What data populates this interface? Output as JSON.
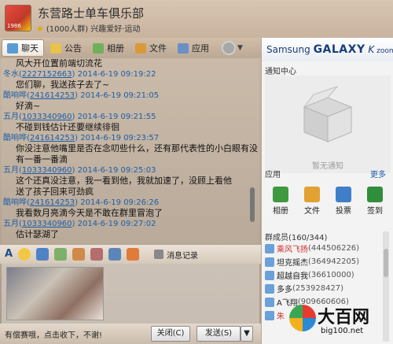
{
  "header": {
    "group_name": "东营路士单车俱乐部",
    "member_info": "(1000人群) 兴趣爱好·运动",
    "avatar_text": "1986"
  },
  "tabs": [
    {
      "label": "聊天",
      "icon": "chat-icon"
    },
    {
      "label": "公告",
      "icon": "notice-icon"
    },
    {
      "label": "相册",
      "icon": "album-icon"
    },
    {
      "label": "文件",
      "icon": "file-icon"
    },
    {
      "label": "应用",
      "icon": "app-icon"
    }
  ],
  "messages": [
    {
      "kind": "body",
      "text": "风大开位置前端切流花"
    },
    {
      "kind": "head",
      "name": "冬水",
      "qq": "2227152663",
      "time": "2014-6-19 09:19:22"
    },
    {
      "kind": "body",
      "text": "您们聊，我送孩子去了~"
    },
    {
      "kind": "head",
      "name": "酷响哗",
      "qq": "241614253",
      "time": "2014-6-19 09:21:05"
    },
    {
      "kind": "body",
      "text": "好滴~"
    },
    {
      "kind": "head",
      "name": "五月",
      "qq": "1033340960",
      "time": "2014-6-19 09:21:55"
    },
    {
      "kind": "body",
      "text": "不碰到钱估计还要继续徘徊"
    },
    {
      "kind": "head",
      "name": "酷响哗",
      "qq": "241614253",
      "time": "2014-6-19 09:23:57"
    },
    {
      "kind": "body",
      "text": "你没注意他嘴里是否在念叨些什么，还有那代表性的小白眼有没"
    },
    {
      "kind": "body",
      "text": "有一番一番滴"
    },
    {
      "kind": "head",
      "name": "五月",
      "qq": "1033340960",
      "time": "2014-6-19 09:25:03"
    },
    {
      "kind": "body",
      "text": "这个还真没注意，我一看到他，我就加速了，没顾上看他"
    },
    {
      "kind": "body",
      "text": "送了孩子回来可劲疯"
    },
    {
      "kind": "head",
      "name": "酷响哗",
      "qq": "241614253",
      "time": "2014-6-19 09:26:26"
    },
    {
      "kind": "body",
      "text": "我看数月亮滴今天是不敢在群里冒泡了"
    },
    {
      "kind": "head",
      "name": "五月",
      "qq": "1033340960",
      "time": "2014-6-19 09:27:02"
    },
    {
      "kind": "body",
      "text": "估计瑟湖了"
    }
  ],
  "toolbar": {
    "font_label": "A",
    "history_label": "消息记录"
  },
  "bottom": {
    "ad_text": "有偿赛哦，点击收下，不谢!",
    "close_label": "关闭(C)",
    "send_label": "发送(S)",
    "send_arrow": "▼"
  },
  "right": {
    "brand_prefix": "Samsung ",
    "brand_name": "GALAXY",
    "brand_k": "K",
    "brand_suffix": " zoom",
    "notice_title": "通知中心",
    "notice_empty": "暂无通知",
    "apps_title": "应用",
    "more_label": "更多",
    "apps": [
      {
        "label": "相册",
        "icon": "album-icon"
      },
      {
        "label": "文件",
        "icon": "file-icon"
      },
      {
        "label": "投票",
        "icon": "vote-icon"
      },
      {
        "label": "签到",
        "icon": "sign-in-icon"
      }
    ],
    "members_title": "群成员(160/344)",
    "members": [
      {
        "name": "乘风飞扬",
        "qq": "(444506226)",
        "red": true
      },
      {
        "name": "坦克摇杰",
        "qq": "(364942205)",
        "red": false
      },
      {
        "name": "超越自我",
        "qq": "(36610000)",
        "red": false
      },
      {
        "name": "多多",
        "qq": "(253928427)",
        "red": false
      },
      {
        "name": "A飞翔",
        "qq": "(909660606)",
        "red": false
      },
      {
        "name": "朱",
        "qq": "",
        "red": true
      }
    ]
  },
  "watermark": {
    "title": "大百网",
    "url": "big100.net"
  }
}
